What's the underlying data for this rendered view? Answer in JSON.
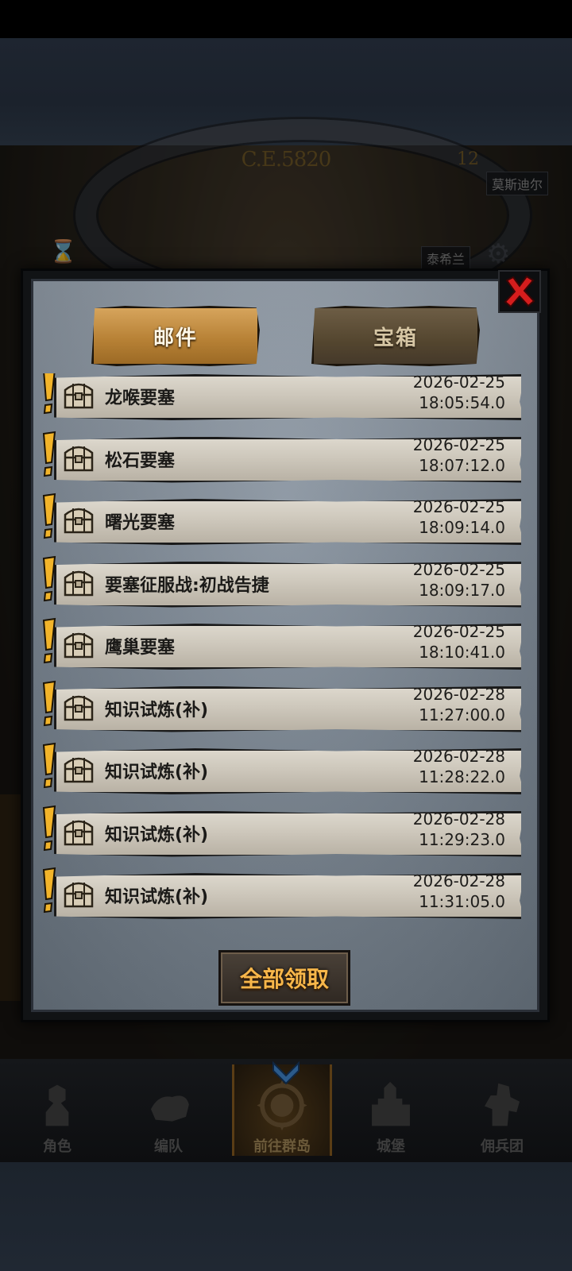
{
  "background": {
    "era": "C.E.5820",
    "era_marker": "12",
    "locations": [
      "莫斯迪尔",
      "泰希兰"
    ]
  },
  "mail_dialog": {
    "tabs": [
      {
        "label": "邮件",
        "active": true
      },
      {
        "label": "宝箱",
        "active": false
      }
    ],
    "mails": [
      {
        "title": "龙喉要塞",
        "date": "2026-02-25",
        "time": "18:05:54.0"
      },
      {
        "title": "松石要塞",
        "date": "2026-02-25",
        "time": "18:07:12.0"
      },
      {
        "title": "曙光要塞",
        "date": "2026-02-25",
        "time": "18:09:14.0"
      },
      {
        "title": "要塞征服战:初战告捷",
        "date": "2026-02-25",
        "time": "18:09:17.0"
      },
      {
        "title": "鹰巢要塞",
        "date": "2026-02-25",
        "time": "18:10:41.0"
      },
      {
        "title": "知识试炼(补)",
        "date": "2026-02-28",
        "time": "11:27:00.0"
      },
      {
        "title": "知识试炼(补)",
        "date": "2026-02-28",
        "time": "11:28:22.0"
      },
      {
        "title": "知识试炼(补)",
        "date": "2026-02-28",
        "time": "11:29:23.0"
      },
      {
        "title": "知识试炼(补)",
        "date": "2026-02-28",
        "time": "11:31:05.0"
      }
    ],
    "claim_all_label": "全部领取"
  },
  "bottom_nav": [
    {
      "label": "角色",
      "icon": "knight-icon"
    },
    {
      "label": "编队",
      "icon": "team-icon"
    },
    {
      "label": "前往群岛",
      "icon": "compass-icon",
      "active": true
    },
    {
      "label": "城堡",
      "icon": "castle-icon"
    },
    {
      "label": "佣兵团",
      "icon": "mercenary-icon"
    }
  ],
  "colors": {
    "tab_active": "#c08a3e",
    "claim_text": "#f7b64a",
    "close_x": "#d51d1d"
  }
}
